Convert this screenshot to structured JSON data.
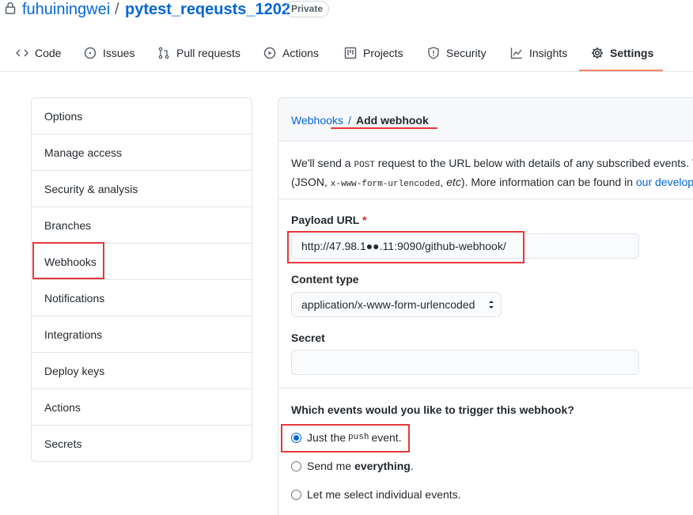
{
  "repo": {
    "owner": "fuhuiningwei",
    "separator": "/",
    "name": "pytest_reqeusts_1202",
    "visibility": "Private"
  },
  "tabs": [
    {
      "label": "Code",
      "icon": "code-icon"
    },
    {
      "label": "Issues",
      "icon": "issue-opened-icon"
    },
    {
      "label": "Pull requests",
      "icon": "pull-request-icon"
    },
    {
      "label": "Actions",
      "icon": "play-icon"
    },
    {
      "label": "Projects",
      "icon": "project-icon"
    },
    {
      "label": "Security",
      "icon": "shield-icon"
    },
    {
      "label": "Insights",
      "icon": "graph-icon"
    },
    {
      "label": "Settings",
      "icon": "gear-icon",
      "selected": true
    }
  ],
  "sidebar": {
    "items": [
      {
        "label": "Options"
      },
      {
        "label": "Manage access"
      },
      {
        "label": "Security & analysis"
      },
      {
        "label": "Branches"
      },
      {
        "label": "Webhooks",
        "active": true
      },
      {
        "label": "Notifications"
      },
      {
        "label": "Integrations"
      },
      {
        "label": "Deploy keys"
      },
      {
        "label": "Actions"
      },
      {
        "label": "Secrets"
      }
    ]
  },
  "panel": {
    "breadcrumb_link": "Webhooks",
    "breadcrumb_sep": "/",
    "breadcrumb_current": "Add webhook",
    "intro_line1_a": "We'll send a ",
    "intro_line1_code": "POST",
    "intro_line1_b": " request to the URL below with details of any subscribed events. Y",
    "intro_line2_a": "(JSON, ",
    "intro_line2_code": "x-www-form-urlencoded",
    "intro_line2_b": ", ",
    "intro_line2_etc": "etc",
    "intro_line2_c": "). More information can be found in ",
    "intro_line2_link": "our develope",
    "payload_label": "Payload URL",
    "payload_required": "*",
    "payload_value": "http://47.98.1●●.11:9090/github-webhook/",
    "content_type_label": "Content type",
    "content_type_value": "application/x-www-form-urlencoded",
    "secret_label": "Secret",
    "secret_value": "",
    "events_question": "Which events would you like to trigger this webhook?",
    "radio_push_a": "Just the ",
    "radio_push_code": "push",
    "radio_push_b": " event.",
    "radio_everything_a": "Send me ",
    "radio_everything_b": "everything",
    "radio_everything_c": ".",
    "radio_individual": "Let me select individual events."
  },
  "colors": {
    "link": "#0366d6",
    "tab_underline": "#f9826c",
    "annotation_red": "#e5383b"
  }
}
